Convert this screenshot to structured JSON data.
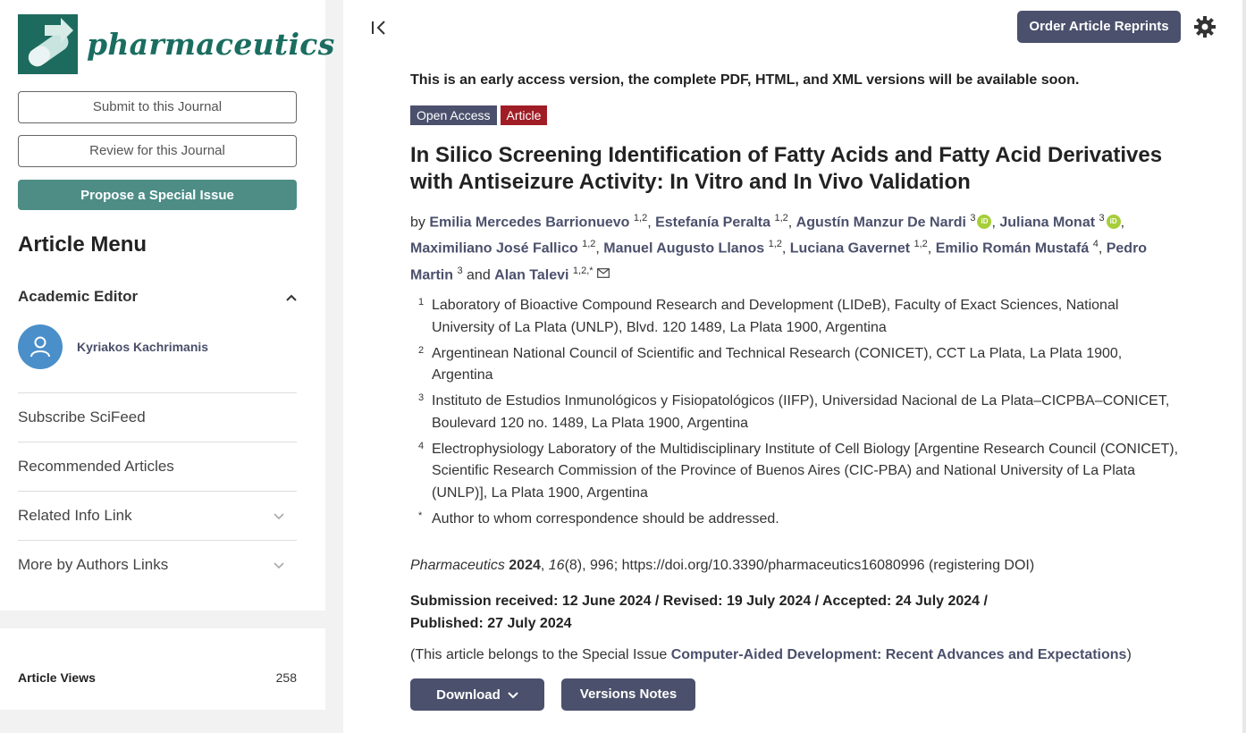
{
  "sidebar": {
    "logo_text": "pharmaceutics",
    "submit_label": "Submit to this Journal",
    "review_label": "Review for this Journal",
    "propose_label": "Propose a Special Issue",
    "menu_title": "Article Menu",
    "academic_editor_label": "Academic Editor",
    "editor_name": "Kyriakos Kachrimanis",
    "items": [
      {
        "label": "Subscribe SciFeed",
        "expandable": false
      },
      {
        "label": "Recommended Articles",
        "expandable": false
      },
      {
        "label": "Related Info Link",
        "expandable": true
      },
      {
        "label": "More by Authors Links",
        "expandable": true
      }
    ],
    "views_label": "Article Views",
    "views_count": "258"
  },
  "header": {
    "reprints_label": "Order Article Reprints"
  },
  "article": {
    "early_access": "This is an early access version, the complete PDF, HTML, and XML versions will be available soon.",
    "tag_open_access": "Open Access",
    "tag_article": "Article",
    "title": "In Silico Screening Identification of Fatty Acids and Fatty Acid Derivatives with Antiseizure Activity: In Vitro and In Vivo Validation",
    "by": "by ",
    "and": "and ",
    "authors": [
      {
        "name": "Emilia Mercedes Barrionuevo",
        "sup": "1,2"
      },
      {
        "name": "Estefanía Peralta",
        "sup": "1,2"
      },
      {
        "name": "Agustín Manzur De Nardi",
        "sup": "3"
      },
      {
        "name": "Juliana Monat",
        "sup": "3"
      },
      {
        "name": "Maximiliano José Fallico",
        "sup": "1,2"
      },
      {
        "name": "Manuel Augusto Llanos",
        "sup": "1,2"
      },
      {
        "name": "Luciana Gavernet",
        "sup": "1,2"
      },
      {
        "name": "Emilio Román Mustafá",
        "sup": "4"
      },
      {
        "name": "Pedro Martin",
        "sup": "3"
      },
      {
        "name": "Alan Talevi",
        "sup": "1,2,*"
      }
    ],
    "affiliations": [
      {
        "num": "1",
        "text": "Laboratory of Bioactive Compound Research and Development (LIDeB), Faculty of Exact Sciences, National University of La Plata (UNLP), Blvd. 120 1489, La Plata 1900, Argentina"
      },
      {
        "num": "2",
        "text": "Argentinean National Council of Scientific and Technical Research (CONICET), CCT La Plata, La Plata 1900, Argentina"
      },
      {
        "num": "3",
        "text": "Instituto de Estudios Inmunológicos y Fisiopatológicos (IIFP), Universidad Nacional de La Plata–CICPBA–CONICET, Boulevard 120 no. 1489, La Plata 1900, Argentina"
      },
      {
        "num": "4",
        "text": "Electrophysiology Laboratory of the Multidisciplinary Institute of Cell Biology [Argentine Research Council (CONICET), Scientific Research Commission of the Province of Buenos Aires (CIC-PBA) and National University of La Plata (UNLP)], La Plata 1900, Argentina"
      },
      {
        "num": "*",
        "text": "Author to whom correspondence should be addressed."
      }
    ],
    "citation": {
      "journal": "Pharmaceutics",
      "year": "2024",
      "volume": "16",
      "rest": "(8), 996; https://doi.org/10.3390/pharmaceutics16080996 (registering DOI)"
    },
    "dates": "Submission received: 12 June 2024 / Revised: 19 July 2024 / Accepted: 24 July 2024 / Published: 27 July 2024",
    "special_issue_prefix": "(This article belongs to the Special Issue ",
    "special_issue_name": "Computer-Aided Development: Recent Advances and Expectations",
    "special_issue_suffix": ")",
    "download_label": "Download",
    "versions_label": "Versions Notes"
  }
}
